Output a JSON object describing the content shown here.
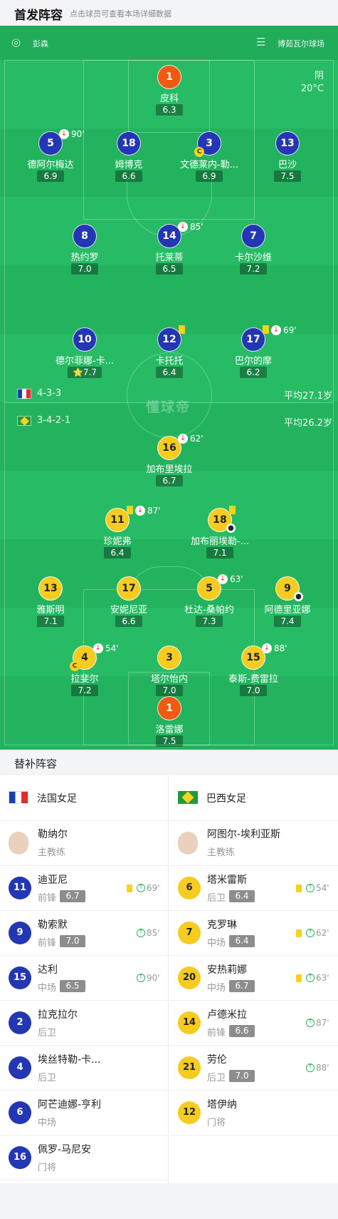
{
  "header": {
    "title": "首发阵容",
    "subtitle": "点击球员可查看本场详细数据"
  },
  "pitch": {
    "referee": "彭森",
    "stadium": "博茹瓦尔球场",
    "weather": "阴",
    "temperature": "20°C",
    "brand": "懂球帝",
    "home_formation": "4-3-3",
    "home_avg_age": "平均27.1岁",
    "away_formation": "3-4-2-1",
    "away_avg_age": "平均26.2岁"
  },
  "home_players": [
    {
      "num": "1",
      "name": "皮科",
      "rating": "6.3",
      "color": "orange"
    },
    {
      "num": "5",
      "name": "德阿尔梅达",
      "rating": "6.9",
      "sub": "90'"
    },
    {
      "num": "18",
      "name": "姆博克",
      "rating": "6.6"
    },
    {
      "num": "3",
      "name": "文德莱内-勒...",
      "rating": "6.9",
      "captain": "C"
    },
    {
      "num": "13",
      "name": "巴沙",
      "rating": "7.5"
    },
    {
      "num": "8",
      "name": "热约罗",
      "rating": "7.0"
    },
    {
      "num": "14",
      "name": "托莱蒂",
      "rating": "6.5",
      "sub": "85'"
    },
    {
      "num": "7",
      "name": "卡尔沙维",
      "rating": "7.2"
    },
    {
      "num": "10",
      "name": "德尔菲娜-卡...",
      "rating": "7.7",
      "star": "⭐"
    },
    {
      "num": "12",
      "name": "卡托托",
      "rating": "6.4"
    },
    {
      "num": "17",
      "name": "巴尔的摩",
      "rating": "6.2",
      "sub": "69'"
    }
  ],
  "away_players": [
    {
      "num": "16",
      "name": "加布里埃拉",
      "rating": "6.7",
      "sub": "62'"
    },
    {
      "num": "11",
      "name": "珍妮弗",
      "rating": "6.4",
      "sub": "87'"
    },
    {
      "num": "18",
      "name": "加布丽埃勒-...",
      "rating": "7.1"
    },
    {
      "num": "13",
      "name": "雅斯明",
      "rating": "7.1"
    },
    {
      "num": "17",
      "name": "安妮尼亚",
      "rating": "6.6"
    },
    {
      "num": "5",
      "name": "杜达-桑帕约",
      "rating": "7.3",
      "sub": "63'"
    },
    {
      "num": "9",
      "name": "阿德里亚娜",
      "rating": "7.4"
    },
    {
      "num": "4",
      "name": "拉斐尔",
      "rating": "7.2",
      "sub": "54'",
      "captain": "C"
    },
    {
      "num": "3",
      "name": "塔尔怡内",
      "rating": "7.0"
    },
    {
      "num": "15",
      "name": "泰斯-费雷拉",
      "rating": "7.0",
      "sub": "88'"
    },
    {
      "num": "1",
      "name": "洛雷娜",
      "rating": "7.5",
      "color": "orange"
    }
  ],
  "subs": {
    "title": "替补阵容",
    "home": {
      "team": "法国女足",
      "coach": {
        "name": "勒纳尔",
        "role": "主教练"
      },
      "players": [
        {
          "num": "11",
          "name": "迪亚尼",
          "pos": "前锋",
          "rating": "6.7",
          "in": "69'",
          "card": true
        },
        {
          "num": "9",
          "name": "勒索默",
          "pos": "前锋",
          "rating": "7.0",
          "in": "85'"
        },
        {
          "num": "15",
          "name": "达利",
          "pos": "中场",
          "rating": "6.5",
          "in": "90'"
        },
        {
          "num": "2",
          "name": "拉克拉尔",
          "pos": "后卫"
        },
        {
          "num": "4",
          "name": "埃丝特勒-卡...",
          "pos": "后卫"
        },
        {
          "num": "6",
          "name": "阿芒迪娜-亨利",
          "pos": "中场"
        },
        {
          "num": "16",
          "name": "佩罗-马尼安",
          "pos": "门将"
        }
      ]
    },
    "away": {
      "team": "巴西女足",
      "coach": {
        "name": "阿图尔-埃利亚斯",
        "role": "主教练"
      },
      "players": [
        {
          "num": "6",
          "name": "塔米雷斯",
          "pos": "后卫",
          "rating": "6.4",
          "in": "54'",
          "card": true
        },
        {
          "num": "7",
          "name": "克罗琳",
          "pos": "中场",
          "rating": "6.4",
          "in": "62'",
          "card": true
        },
        {
          "num": "20",
          "name": "安热莉娜",
          "pos": "中场",
          "rating": "6.7",
          "in": "63'",
          "card": true
        },
        {
          "num": "14",
          "name": "卢德米拉",
          "pos": "前锋",
          "rating": "6.6",
          "in": "87'"
        },
        {
          "num": "21",
          "name": "劳伦",
          "pos": "后卫",
          "rating": "7.0",
          "in": "88'"
        },
        {
          "num": "12",
          "name": "塔伊纳",
          "pos": "门将"
        }
      ]
    }
  }
}
